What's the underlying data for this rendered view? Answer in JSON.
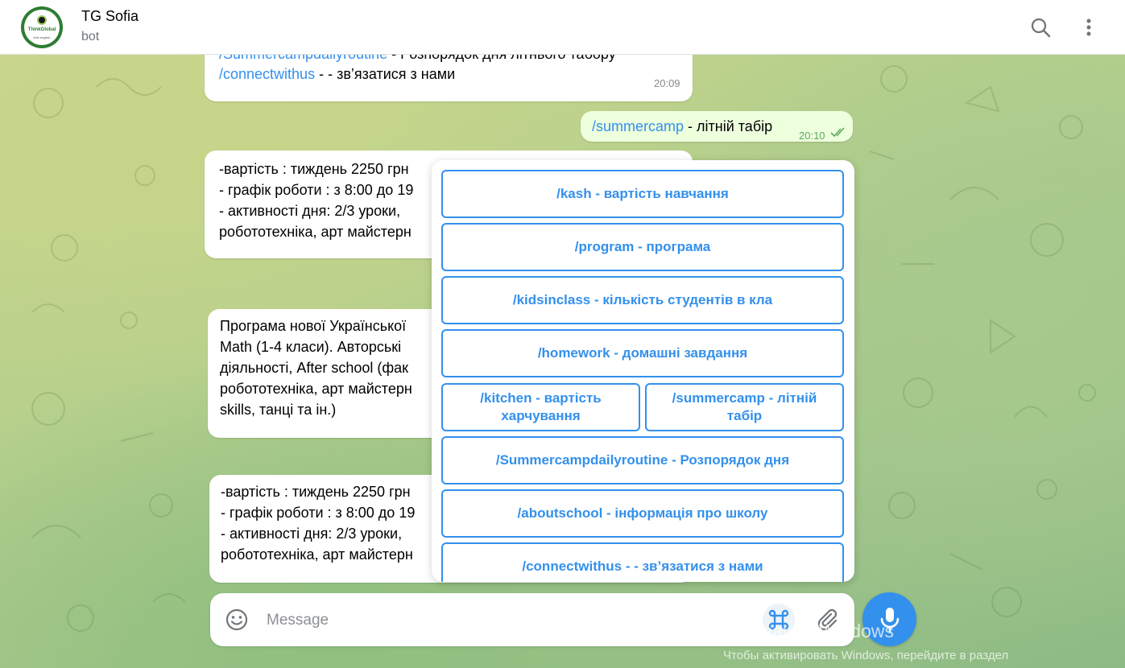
{
  "header": {
    "title": "TG Sofia",
    "subtitle": "bot",
    "avatar_text": "ThinkGlobal",
    "avatar_subtext": "kids english"
  },
  "messages": {
    "m1": {
      "line1_cmd": "/Summercampdailyroutine",
      "line1_text": " - Розпорядок дня літнього табору",
      "line2_cmd": "/connectwithus",
      "line2_text": " - - зв’язатися з нами",
      "time": "20:09"
    },
    "m2": {
      "cmd": "/summercamp",
      "text": " - літній табір",
      "time": "20:10"
    },
    "m3": {
      "lines": [
        "-вартість : тиждень 2250 грн",
        "- графік роботи : з 8:00 до 19",
        "- активності дня: 2/3 уроки,",
        "робототехніка, арт майстерн"
      ]
    },
    "m4": {
      "lines": [
        "Програма нової Української",
        "Math (1-4 класи). Авторські",
        "діяльності, After school (фак",
        "робототехніка, арт майстерн",
        "skills, танці та ін.)"
      ]
    },
    "m5": {
      "lines": [
        "-вартість : тиждень 2250 грн",
        "- графік роботи : з 8:00 до 19",
        "- активності дня: 2/3 уроки,",
        "робототехніка, арт майстерн"
      ]
    }
  },
  "keyboard": {
    "kash": "/kash - вартість навчання",
    "program": "/program - програма",
    "kidsinclass": "/kidsinclass - кількість студентів в кла",
    "homework": "/homework - домашні завдання",
    "kitchen": "/kitchen - вартість харчування",
    "summercamp": "/summercamp - літній табір",
    "daily": "/Summercampdailyroutine - Розпорядок дня",
    "aboutschool": "/aboutschool - інформація про школу",
    "connect": "/connectwithus - - зв’язатися з нами"
  },
  "composer": {
    "placeholder": "Message",
    "value": ""
  },
  "watermark": {
    "line1": "Активация Windows",
    "line2": "Чтобы активировать Windows, перейдите в раздел"
  },
  "colors": {
    "accent": "#3390ec",
    "outgoing_bubble": "#eeffde",
    "avatar_ring": "#2e7d32"
  },
  "icons": [
    "search-icon",
    "more-vertical-icon",
    "emoji-icon",
    "command-icon",
    "paperclip-icon",
    "microphone-icon",
    "double-check-icon"
  ]
}
